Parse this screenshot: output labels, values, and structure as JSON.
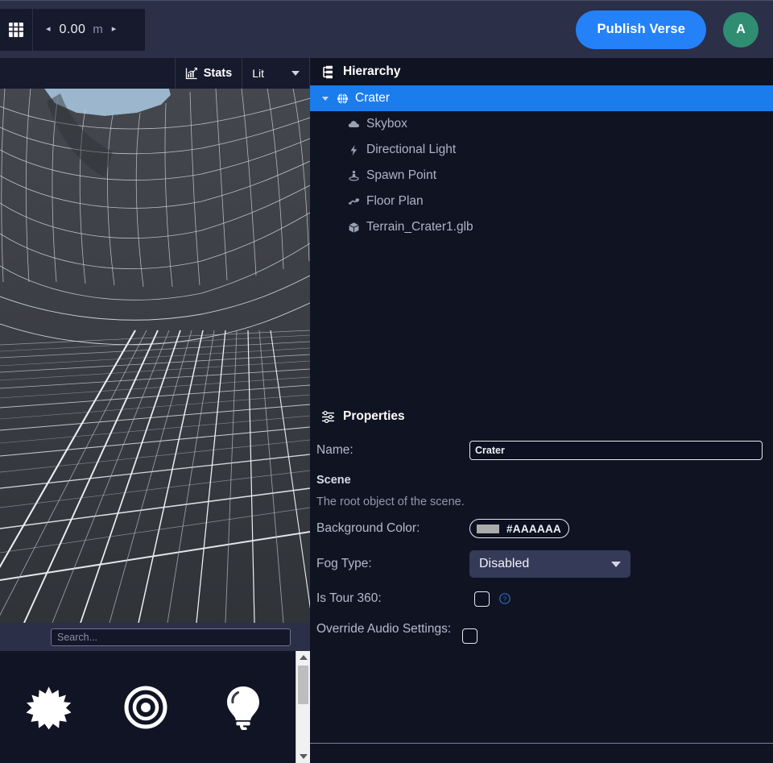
{
  "topbar": {
    "grid_icon": "grid-icon",
    "snap": {
      "prev_arrow": "◂",
      "value": "0.00",
      "unit": "m",
      "next_arrow": "▸"
    },
    "publish_label": "Publish Verse",
    "avatar_initial": "A",
    "accent_color": "#2481f7",
    "avatar_color": "#2f8d72"
  },
  "viewport_toolbar": {
    "stats_label": "Stats",
    "stats_icon": "chart-line-icon",
    "shading_mode": "Lit",
    "shading_options": [
      "Lit"
    ]
  },
  "viewport": {
    "description": "3D wireframe terrain crater view with sky"
  },
  "hierarchy": {
    "title": "Hierarchy",
    "title_icon": "tree-structure-icon",
    "selected_color": "#1b7ced",
    "items": [
      {
        "label": "Crater",
        "icon": "globe-icon",
        "depth": 0,
        "selected": true,
        "expanded": true
      },
      {
        "label": "Skybox",
        "icon": "cloud-icon",
        "depth": 1,
        "selected": false
      },
      {
        "label": "Directional Light",
        "icon": "lightning-bolt-icon",
        "depth": 1,
        "selected": false
      },
      {
        "label": "Spawn Point",
        "icon": "spawn-point-icon",
        "depth": 1,
        "selected": false
      },
      {
        "label": "Floor Plan",
        "icon": "floor-plan-icon",
        "depth": 1,
        "selected": false
      },
      {
        "label": "Terrain_Crater1.glb",
        "icon": "cube-icon",
        "depth": 1,
        "selected": false
      }
    ]
  },
  "properties": {
    "title": "Properties",
    "title_icon": "sliders-icon",
    "name_label": "Name:",
    "name_value": "Crater",
    "section_title": "Scene",
    "section_description": "The root object of the scene.",
    "background_color_label": "Background Color:",
    "background_color_value": "#AAAAAA",
    "background_color_swatch": "#aaaaaa",
    "fog_type_label": "Fog Type:",
    "fog_type_value": "Disabled",
    "fog_type_options": [
      "Disabled"
    ],
    "is_tour_360_label": "Is Tour 360:",
    "is_tour_360_checked": false,
    "is_tour_360_help_icon": "question-circle-icon",
    "override_audio_label": "Override Audio Settings:",
    "override_audio_checked": false
  },
  "assets": {
    "search_placeholder": "Search...",
    "search_value": "",
    "items": [
      {
        "icon": "starburst-icon",
        "name": "asset-starburst"
      },
      {
        "icon": "bullseye-icon",
        "name": "asset-bullseye"
      },
      {
        "icon": "lightbulb-icon",
        "name": "asset-lightbulb"
      }
    ],
    "scrollbar": {
      "up_arrow": "▲",
      "down_arrow": "▼"
    }
  }
}
